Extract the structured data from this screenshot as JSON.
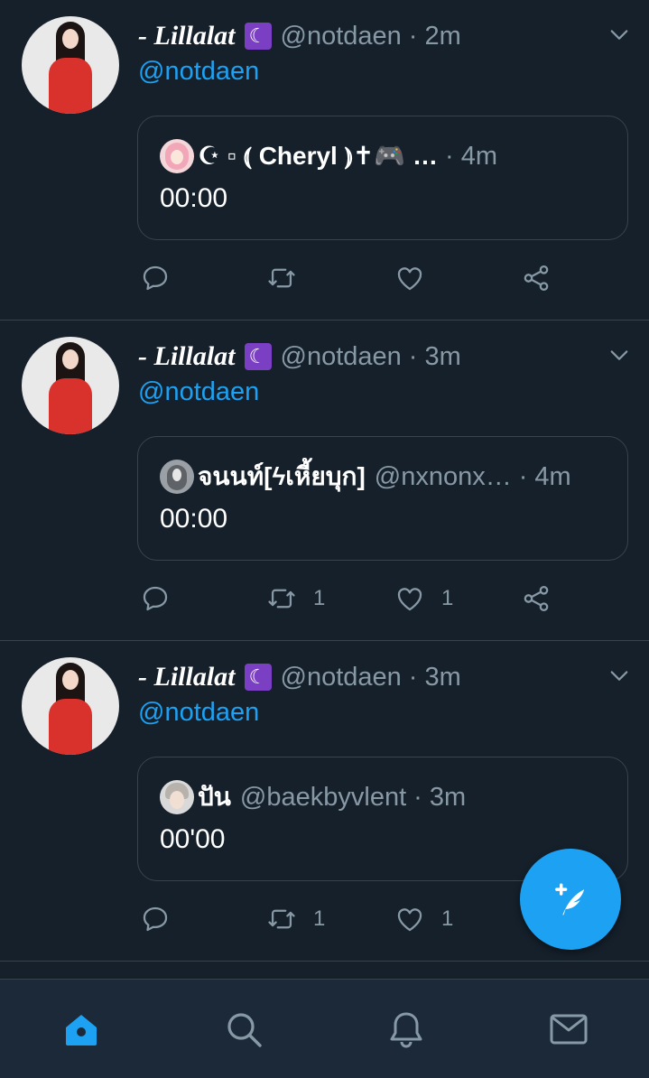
{
  "colors": {
    "background": "#15202b",
    "accent": "#1da1f2",
    "muted": "#8899a6",
    "border": "#38444d",
    "nav_bg": "#1c2938"
  },
  "tweets": [
    {
      "name": "- Lillalat",
      "emoji": "☾",
      "handle": "@notdaen",
      "dot": "·",
      "time": "2m",
      "reply_to": "@notdaen",
      "quote": {
        "avatar_icon": "pink-hair-avatar",
        "name": "☪︎ ▫︎ ⦅ Cheryl ⦆✝🎮 …",
        "handle": "",
        "dot": "·",
        "time": "4m",
        "text": "00:00"
      },
      "actions": {
        "reply": "",
        "retweet": "",
        "like": ""
      }
    },
    {
      "name": "- Lillalat",
      "emoji": "☾",
      "handle": "@notdaen",
      "dot": "·",
      "time": "3m",
      "reply_to": "@notdaen",
      "quote": {
        "avatar_icon": "grey-photo-avatar",
        "name": "จนนท์[ϟเหี้ยบุก]",
        "handle": "@nxnonx…",
        "dot": "·",
        "time": "4m",
        "text": "00:00"
      },
      "actions": {
        "reply": "",
        "retweet": "1",
        "like": "1"
      }
    },
    {
      "name": "- Lillalat",
      "emoji": "☾",
      "handle": "@notdaen",
      "dot": "·",
      "time": "3m",
      "reply_to": "@notdaen",
      "quote": {
        "avatar_icon": "boy-photo-avatar",
        "name": "ปัน",
        "handle": "@baekbyvlent",
        "dot": "·",
        "time": "3m",
        "text": "00'00"
      },
      "actions": {
        "reply": "",
        "retweet": "1",
        "like": "1"
      }
    }
  ],
  "nav": {
    "home": "home-icon",
    "search": "search-icon",
    "notifications": "bell-icon",
    "messages": "mail-icon",
    "active": "home"
  },
  "fab": {
    "icon": "compose-tweet-icon"
  }
}
